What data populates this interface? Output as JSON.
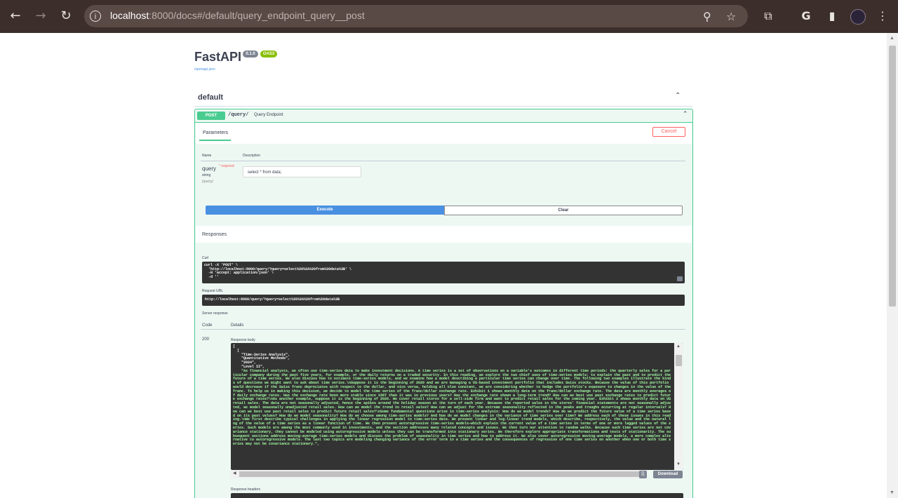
{
  "browser": {
    "url_host": "localhost",
    "url_path": ":8000/docs#/default/query_endpoint_query__post"
  },
  "api": {
    "title": "FastAPI",
    "version_badge": "0.1.0",
    "oas_badge": "OAS3",
    "spec_link": "/openapi.json"
  },
  "tag": {
    "name": "default"
  },
  "operation": {
    "method": "POST",
    "path": "/query/",
    "summary": "Query Endpoint",
    "params_tab": "Parameters",
    "cancel_label": "Cancel",
    "col_name": "Name",
    "col_description": "Description",
    "param": {
      "name": "query",
      "required": "* required",
      "type": "string",
      "in": "(query)",
      "value": "select * from data;"
    },
    "execute_label": "Execute",
    "clear_label": "Clear"
  },
  "responses": {
    "title": "Responses",
    "curl_label": "Curl",
    "curl_lines": "curl -X 'POST' \\\n  'http://localhost:8000/query/?query=select%20%2A%20from%20data%3B' \\\n  -H 'accept: application/json' \\\n  -d ''",
    "request_url_label": "Request URL",
    "request_url": "http://localhost:8000/query/?query=select%20%2A%20from%20data%3B",
    "server_response_label": "Server response",
    "code_header": "Code",
    "details_header": "Details",
    "status_code": "200",
    "body_label": "Response body",
    "body_open": "[\n  [\n    \"Time-Series Analysis\",\n    \"Quantitative Methods\",\n    \"2024\",\n    \"Level II\",",
    "body_text": "    \"As financial analysts, we often use time-series data to make investment decisions. A time series is a set of observations on a variable's outcomes in different time periods: the quarterly sales for a particular company during the past five years, for example, or the daily returns on a traded security. In this reading, we explore the two chief uses of time-series models: to explain the past and to predict the future of a time series. We also discuss how to estimate time-series models, and we examine how a model describing a particular time series can change over time. The following two examples illustrate the kinds of questions we might want to ask about time series.\\nSuppose it is the beginning of 2020 and we are managing a US-based investment portfolio that includes Swiss stocks. Because the value of this portfolio would decrease if the Swiss franc depreciates with respect to the dollar, and vice versa, holding all else constant, we are considering whether to hedge the portfolio's exposure to changes in the value of the franc. To help us in making this decision, we decide to model the time series of the franc/dollar exchange rate. Exhibit 1 shows monthly data on the franc/dollar exchange rate. The data are monthly averages of daily exchange rates. Has the exchange rate been more stable since 1987 than it was in previous years? Has the exchange rate shown a long-term trend? How can we best use past exchange rates to predict future exchange rates?\\nAs another example, suppose it is the beginning of 2020. We cover retail stores for a sell-side firm and want to predict retail sales for the coming year. Exhibit 2 shows monthly data on US retail sales. The data are not seasonally adjusted, hence the spikes around the holiday season at the turn of each year. Because the reported sales in the stores' financial statements are not seasonally adjusted, we model seasonally unadjusted retail sales. How can we model the trend in retail sales? How can we adjust for the extreme seasonality reflected in the peaks and troughs occurring at regular intervals? How can we best use past retail sales to predict future retail sales?\\nSome fundamental questions arise in time-series analysis: How do we model trends? How do we predict the future value of a time series based on its past values? How do we model seasonality? How do we choose among time-series models? And how do we model changes in the variance of time series over time? We address each of these issues in this reading.\\nWe first describe typical challenges in applying the linear regression model to time-series data. We present linear and log-linear trend models, which describe, respectively, the value and the natural log of the value of a time series as a linear function of time. We then present autoregressive time-series models—which explain the current value of a time series in terms of one or more lagged values of the series. Such models are among the most commonly used in investments, and the section addresses many related concepts and issues. We then turn our attention to random walks. Because such time series are not covariance stationary, they cannot be modeled using autoregressive models unless they can be transformed into stationary series. We therefore explore appropriate transformations and tests of stationarity. The subsequent sections address moving-average time-series models and discuss the problem of seasonality in time series and how to address it. We also cover autoregressive moving-average models, a more complex alternative to autoregressive models. The last two topics are modeling changing variance of the error term in a time series and the consequences of regression of one time series on another when one or both time series may not be covariance stationary.\",",
    "download_label": "Download",
    "headers_label": "Response headers"
  }
}
